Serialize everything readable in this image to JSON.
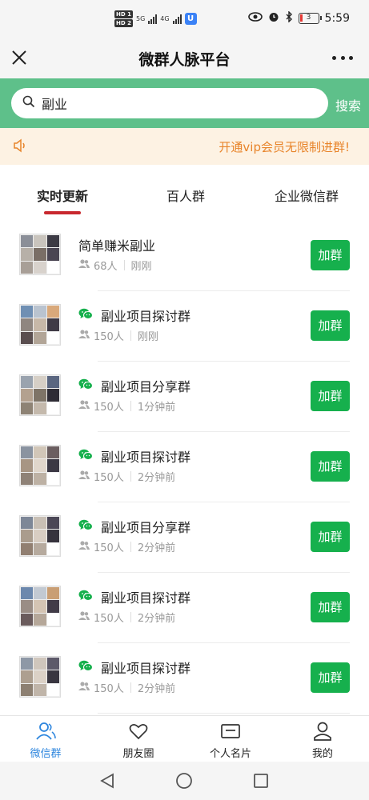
{
  "status_bar": {
    "hd1": "HD 1",
    "hd2": "HD 2",
    "net1": "5G",
    "net2": "4G",
    "battery": "3",
    "time": "5:59"
  },
  "header": {
    "title": "微群人脉平台",
    "close_icon": "close-icon",
    "more_icon": "more-icon"
  },
  "search": {
    "value": "副业",
    "button": "搜索"
  },
  "notice": {
    "text": "开通vip会员无限制进群!"
  },
  "tabs": [
    {
      "label": "实时更新",
      "active": true
    },
    {
      "label": "百人群",
      "active": false
    },
    {
      "label": "企业微信群",
      "active": false
    }
  ],
  "groups": [
    {
      "name": "简单赚米副业",
      "wechat": false,
      "members": "68人",
      "time": "刚刚",
      "join": "加群"
    },
    {
      "name": "副业项目探讨群",
      "wechat": true,
      "members": "150人",
      "time": "刚刚",
      "join": "加群"
    },
    {
      "name": "副业项目分享群",
      "wechat": true,
      "members": "150人",
      "time": "1分钟前",
      "join": "加群"
    },
    {
      "name": "副业项目探讨群",
      "wechat": true,
      "members": "150人",
      "time": "2分钟前",
      "join": "加群"
    },
    {
      "name": "副业项目分享群",
      "wechat": true,
      "members": "150人",
      "time": "2分钟前",
      "join": "加群"
    },
    {
      "name": "副业项目探讨群",
      "wechat": true,
      "members": "150人",
      "time": "2分钟前",
      "join": "加群"
    },
    {
      "name": "副业项目探讨群",
      "wechat": true,
      "members": "150人",
      "time": "2分钟前",
      "join": "加群"
    }
  ],
  "bottom_nav": [
    {
      "label": "微信群",
      "icon": "users-icon",
      "active": true
    },
    {
      "label": "朋友圈",
      "icon": "heart-icon",
      "active": false
    },
    {
      "label": "个人名片",
      "icon": "card-icon",
      "active": false
    },
    {
      "label": "我的",
      "icon": "person-icon",
      "active": false
    }
  ],
  "colors": {
    "accent_green": "#16b04d",
    "search_band": "#5ec08a",
    "notice_text": "#e8842a",
    "tab_indicator": "#c8282e",
    "nav_active": "#2e86de"
  }
}
